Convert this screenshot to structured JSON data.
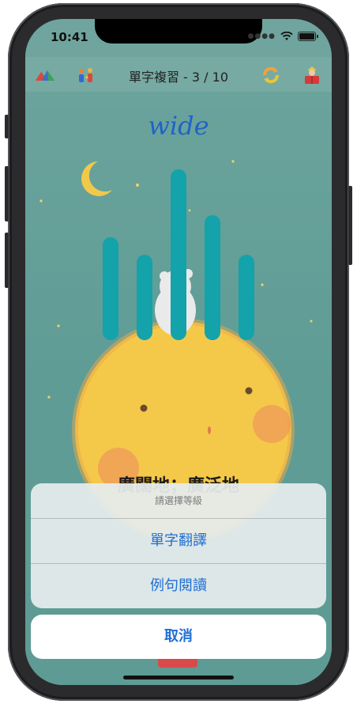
{
  "status_bar": {
    "time": "10:41"
  },
  "navbar": {
    "title": "單字複習 - 3 / 10",
    "icons": [
      "mountain-logo-icon",
      "people-icon",
      "refresh-icon",
      "reading-book-icon"
    ]
  },
  "main": {
    "word": "wide",
    "meaning": "廣闊地；廣泛地",
    "equalizer_levels": [
      0.6,
      0.5,
      1.0,
      0.73,
      0.5
    ]
  },
  "action_sheet": {
    "title": "請選擇等級",
    "options": [
      "單字翻譯",
      "例句閱讀"
    ],
    "cancel": "取消"
  },
  "colors": {
    "accent": "#1f6fd4",
    "background": "#6fa59e",
    "bar": "#14a2ab",
    "moon": "#f4c94a"
  }
}
